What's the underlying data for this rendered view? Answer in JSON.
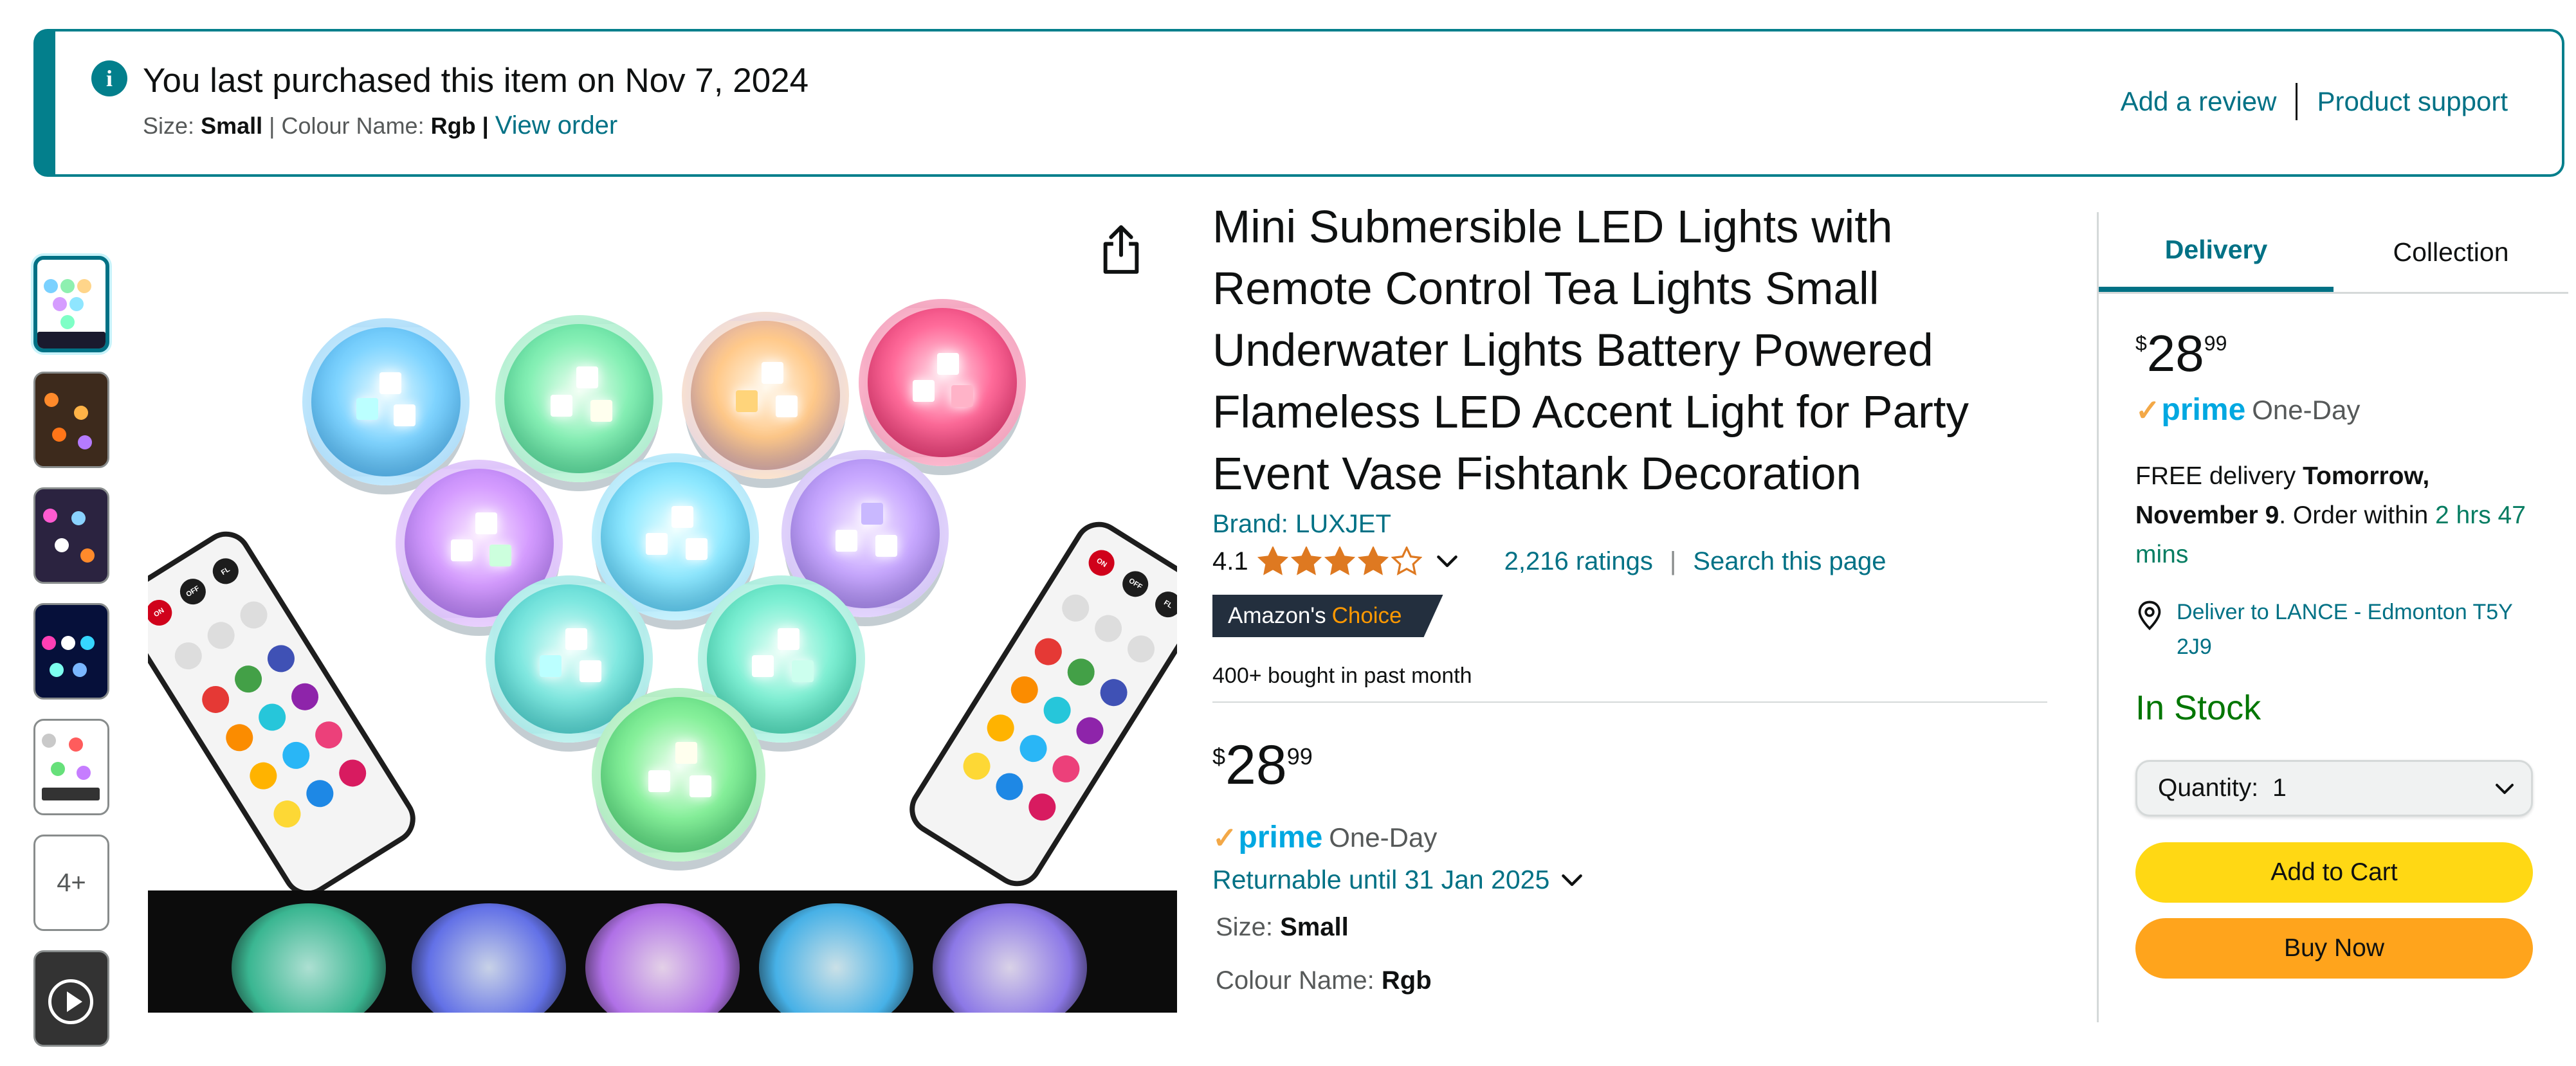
{
  "banner": {
    "headline": "You last purchased this item on Nov 7, 2024",
    "size_label": "Size:",
    "size_value": "Small",
    "colour_label": "Colour Name:",
    "colour_value": "Rgb",
    "separator": "|",
    "view_order": "View order",
    "add_review": "Add a review",
    "product_support": "Product support",
    "info_icon": "info-icon"
  },
  "gallery": {
    "more_label": "4+",
    "thumbnail_count": 7,
    "selected_index": 0
  },
  "product": {
    "title": "Mini Submersible LED Lights with Remote Control Tea Lights Small Underwater Lights Battery Powered Flameless LED Accent Light for Party Event Vase Fishtank Decoration",
    "brand": "Brand: LUXJET",
    "rating_value": "4.1",
    "rating_stars": 4.1,
    "ratings_count": "2,216 ratings",
    "rating_separator": "|",
    "search_page": "Search this page",
    "choice_prefix": "Amazon's",
    "choice_word": "Choice",
    "bought": "400+ bought in past month",
    "price_currency": "$",
    "price_whole": "28",
    "price_fraction": "99",
    "prime_label": "prime",
    "prime_speed": "One-Day",
    "returnable": "Returnable until 31 Jan 2025",
    "size_label": "Size:",
    "size_value": "Small",
    "colour_label": "Colour Name:",
    "colour_value": "Rgb"
  },
  "buybox": {
    "tabs": [
      "Delivery",
      "Collection"
    ],
    "active_tab": "Delivery",
    "price_currency": "$",
    "price_whole": "28",
    "price_fraction": "99",
    "prime_label": "prime",
    "prime_speed": "One-Day",
    "delivery_prefix": "FREE delivery",
    "delivery_date": "Tomorrow, November 9",
    "order_within": ". Order within",
    "countdown": "2 hrs 47 mins",
    "deliver_to": "Deliver to LANCE - Edmonton T5Y 2J9",
    "stock": "In Stock",
    "quantity_label": "Quantity:",
    "quantity_value": "1",
    "add_to_cart": "Add to Cart",
    "buy_now": "Buy Now"
  },
  "colors": {
    "link": "#007185",
    "banner_border": "#037f8c",
    "add_to_cart": "#ffd814",
    "buy_now": "#ffa41c",
    "in_stock": "#007600",
    "prime_blue": "#00a8e1",
    "choice_bg": "#232f3e",
    "choice_orange": "#ff9900"
  }
}
